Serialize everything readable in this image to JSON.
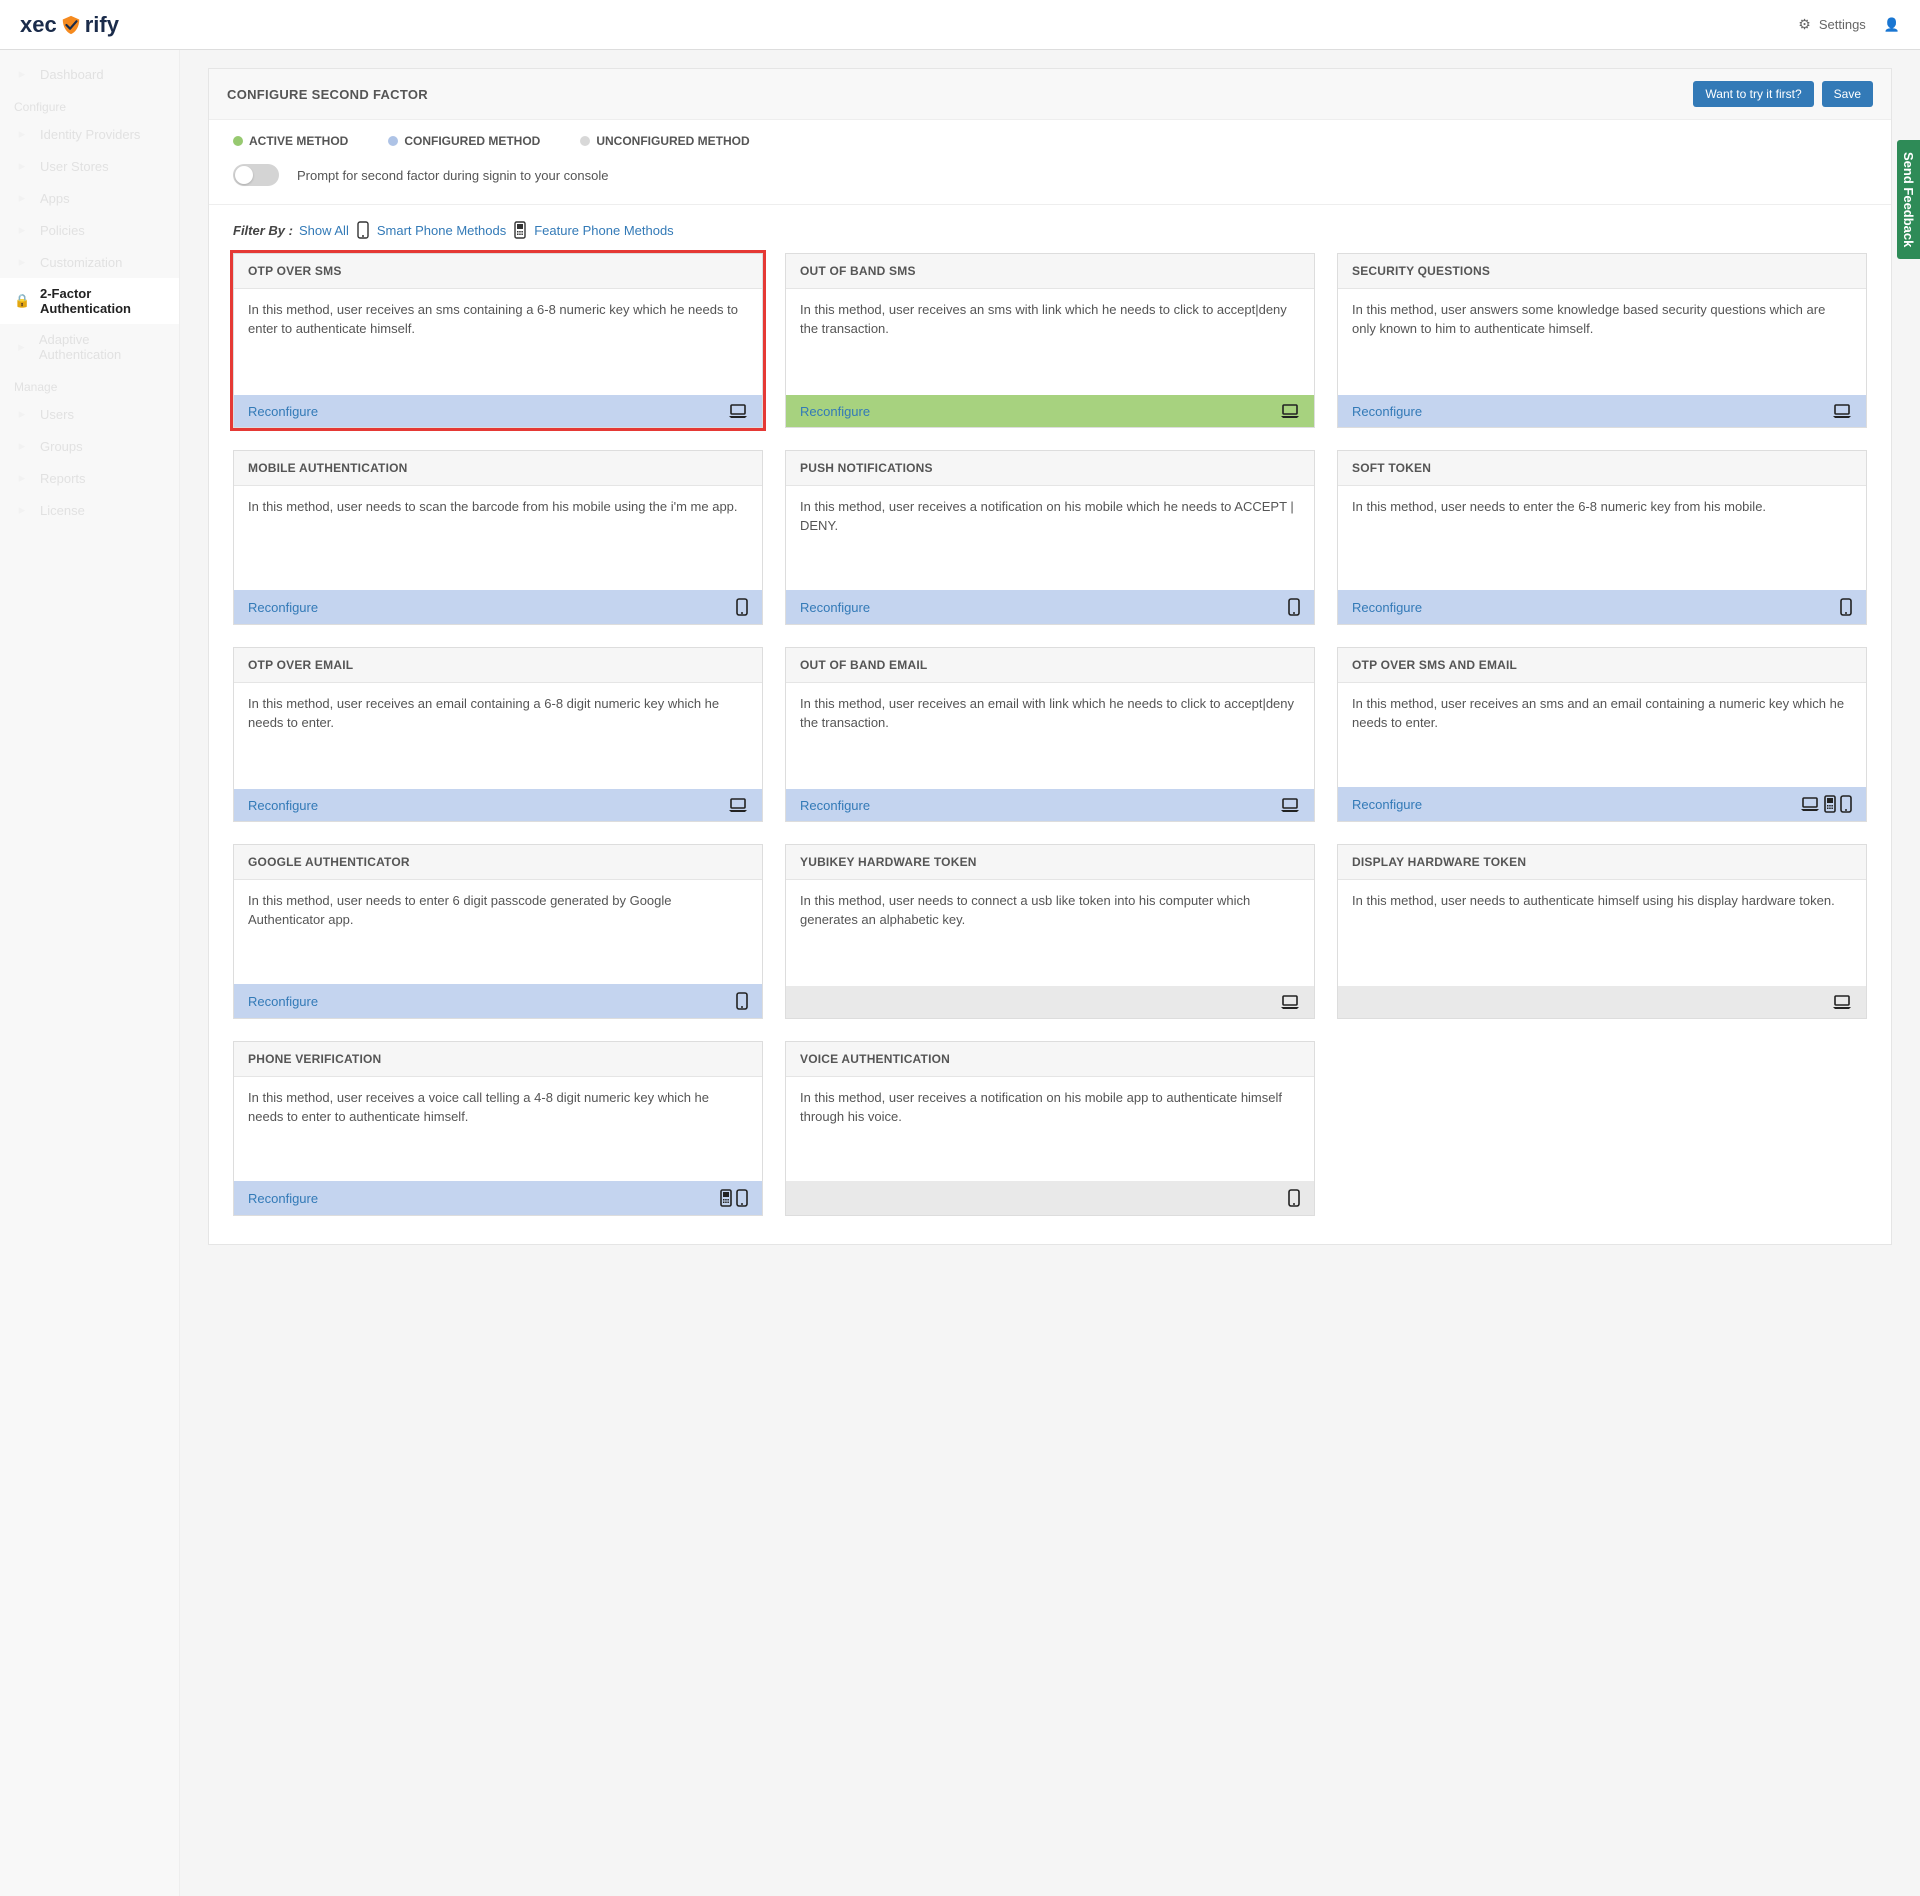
{
  "topbar": {
    "logo_left": "xec",
    "logo_right": "rify",
    "settings": "Settings"
  },
  "sidebar": {
    "items": [
      {
        "label": "Dashboard"
      },
      {
        "label": "Configure",
        "section": true
      },
      {
        "label": "Identity Providers"
      },
      {
        "label": "User Stores"
      },
      {
        "label": "Apps"
      },
      {
        "label": "Policies"
      },
      {
        "label": "Customization"
      },
      {
        "label": "2-Factor Authentication",
        "active": true
      },
      {
        "label": "Adaptive Authentication"
      },
      {
        "label": "Manage",
        "section": true
      },
      {
        "label": "Users"
      },
      {
        "label": "Groups"
      },
      {
        "label": "Reports"
      },
      {
        "label": "License"
      }
    ]
  },
  "panel": {
    "title": "CONFIGURE SECOND FACTOR",
    "try_label": "Want to try it first?",
    "save_label": "Save"
  },
  "legend": {
    "active": "ACTIVE METHOD",
    "configured": "CONFIGURED METHOD",
    "unconfigured": "UNCONFIGURED METHOD"
  },
  "toggle": {
    "label": "Prompt for second factor during signin to your console"
  },
  "filter": {
    "label": "Filter By :",
    "show_all": "Show All",
    "smart": "Smart Phone Methods",
    "feature": "Feature Phone Methods"
  },
  "reconfigure_label": "Reconfigure",
  "cards": [
    {
      "title": "OTP OVER SMS",
      "desc": "In this method, user receives an sms containing a 6-8 numeric key which he needs to enter to authenticate himself.",
      "status": "configured",
      "icons": [
        "laptop"
      ],
      "highlight": true
    },
    {
      "title": "OUT OF BAND SMS",
      "desc": "In this method, user receives an sms with link which he needs to click to accept|deny the transaction.",
      "status": "active",
      "icons": [
        "laptop"
      ]
    },
    {
      "title": "SECURITY QUESTIONS",
      "desc": "In this method, user answers some knowledge based security questions which are only known to him to authenticate himself.",
      "status": "configured",
      "icons": [
        "laptop"
      ]
    },
    {
      "title": "MOBILE AUTHENTICATION",
      "desc": "In this method, user needs to scan the barcode from his mobile using the i'm me app.",
      "status": "configured",
      "icons": [
        "smartphone"
      ]
    },
    {
      "title": "PUSH NOTIFICATIONS",
      "desc": "In this method, user receives a notification on his mobile which he needs to ACCEPT | DENY.",
      "status": "configured",
      "icons": [
        "smartphone"
      ]
    },
    {
      "title": "SOFT TOKEN",
      "desc": "In this method, user needs to enter the 6-8 numeric key from his mobile.",
      "status": "configured",
      "icons": [
        "smartphone"
      ]
    },
    {
      "title": "OTP OVER EMAIL",
      "desc": "In this method, user receives an email containing a 6-8 digit numeric key which he needs to enter.",
      "status": "configured",
      "icons": [
        "laptop"
      ]
    },
    {
      "title": "OUT OF BAND EMAIL",
      "desc": "In this method, user receives an email with link which he needs to click to accept|deny the transaction.",
      "status": "configured",
      "icons": [
        "laptop"
      ]
    },
    {
      "title": "OTP OVER SMS AND EMAIL",
      "desc": "In this method, user receives an sms and an email containing a numeric key which he needs to enter.",
      "status": "configured",
      "icons": [
        "laptop",
        "featurephone",
        "smartphone"
      ]
    },
    {
      "title": "GOOGLE AUTHENTICATOR",
      "desc": "In this method, user needs to enter 6 digit passcode generated by Google Authenticator app.",
      "status": "configured",
      "icons": [
        "smartphone"
      ]
    },
    {
      "title": "YUBIKEY HARDWARE TOKEN",
      "desc": "In this method, user needs to connect a usb like token into his computer which generates an alphabetic key.",
      "status": "unconfigured",
      "icons": [
        "laptop"
      ]
    },
    {
      "title": "DISPLAY HARDWARE TOKEN",
      "desc": "In this method, user needs to authenticate himself using his display hardware token.",
      "status": "unconfigured",
      "icons": [
        "laptop"
      ]
    },
    {
      "title": "PHONE VERIFICATION",
      "desc": "In this method, user receives a voice call telling a 4-8 digit numeric key which he needs to enter to authenticate himself.",
      "status": "configured",
      "icons": [
        "featurephone",
        "smartphone"
      ]
    },
    {
      "title": "VOICE AUTHENTICATION",
      "desc": "In this method, user receives a notification on his mobile app to authenticate himself through his voice.",
      "status": "unconfigured",
      "icons": [
        "smartphone"
      ]
    }
  ],
  "feedback": "Send Feedback"
}
